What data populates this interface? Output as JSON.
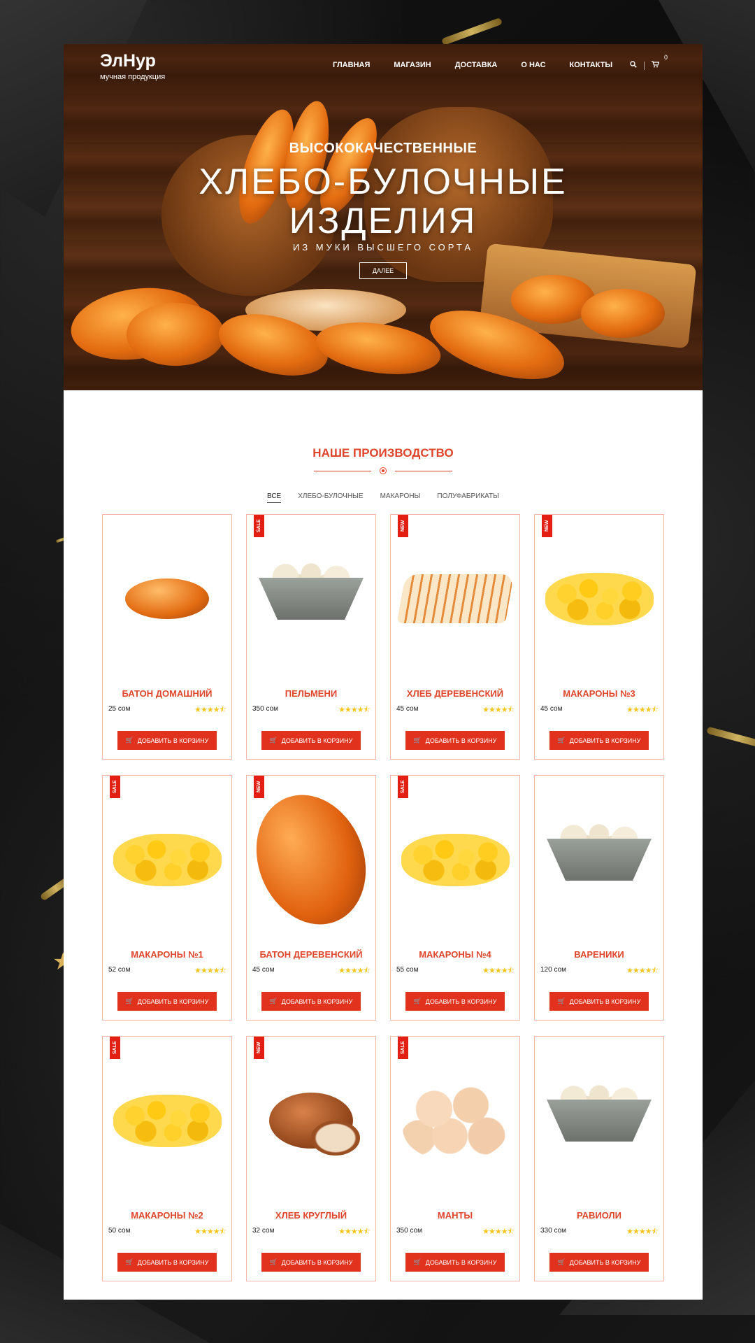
{
  "header": {
    "logo_title": "ЭлНур",
    "logo_subtitle": "мучная продукция",
    "nav": [
      "ГЛАВНАЯ",
      "МАГАЗИН",
      "ДОСТАВКА",
      "О НАС",
      "КОНТАКТЫ"
    ],
    "cart_count": "0"
  },
  "hero": {
    "pre_title": "ВЫСОКОКАЧЕСТВЕННЫЕ",
    "title_line1": "ХЛЕБО-БУЛОЧНЫЕ",
    "title_line2": "ИЗДЕЛИЯ",
    "subtitle": "ИЗ МУКИ ВЫСШЕГО СОРТА",
    "button": "ДАЛЕЕ"
  },
  "section": {
    "title": "НАШЕ ПРОИЗВОДСТВО",
    "filters": [
      "ВСЕ",
      "ХЛЕБО-БУЛОЧНЫЕ",
      "МАКАРОНЫ",
      "ПОЛУФАБРИКАТЫ"
    ],
    "active_filter": "ВСЕ"
  },
  "add_to_cart_label": "ДОБАВИТЬ В КОРЗИНУ",
  "products": [
    {
      "name": "БАТОН ДОМАШНИЙ",
      "price": "25 сом",
      "badge": "",
      "rating": 4.5,
      "art": "bread-long"
    },
    {
      "name": "ПЕЛЬМЕНИ",
      "price": "350 сом",
      "badge": "SALE",
      "rating": 4.5,
      "art": "bowl"
    },
    {
      "name": "ХЛЕБ ДЕРЕВЕНСКИЙ",
      "price": "45 сом",
      "badge": "NEW",
      "rating": 4.5,
      "art": "sliced"
    },
    {
      "name": "МАКАРОНЫ №3",
      "price": "45 сом",
      "badge": "NEW",
      "rating": 4.5,
      "art": "pasta"
    },
    {
      "name": "МАКАРОНЫ №1",
      "price": "52 сом",
      "badge": "SALE",
      "rating": 4.5,
      "art": "pasta"
    },
    {
      "name": "БАТОН ДЕРЕВЕНСКИЙ",
      "price": "45 сом",
      "badge": "NEW",
      "rating": 4.5,
      "art": "bread-big"
    },
    {
      "name": "МАКАРОНЫ №4",
      "price": "55 сом",
      "badge": "SALE",
      "rating": 4.5,
      "art": "pasta"
    },
    {
      "name": "ВАРЕНИКИ",
      "price": "120 сом",
      "badge": "",
      "rating": 4.5,
      "art": "bowl"
    },
    {
      "name": "МАКАРОНЫ №2",
      "price": "50 сом",
      "badge": "SALE",
      "rating": 4.5,
      "art": "pasta"
    },
    {
      "name": "ХЛЕБ КРУГЛЫЙ",
      "price": "32 сом",
      "badge": "NEW",
      "rating": 4.5,
      "art": "bread-round"
    },
    {
      "name": "МАНТЫ",
      "price": "350 сом",
      "badge": "SALE",
      "rating": 4.5,
      "art": "manty"
    },
    {
      "name": "РАВИОЛИ",
      "price": "330 сом",
      "badge": "",
      "rating": 4.5,
      "art": "bowl"
    }
  ],
  "colors": {
    "accent": "#e0452b",
    "button": "#e0321d",
    "badge": "#e31e12",
    "star": "#f4c418"
  },
  "icons": {
    "search": "search-icon",
    "cart": "cart-icon"
  }
}
